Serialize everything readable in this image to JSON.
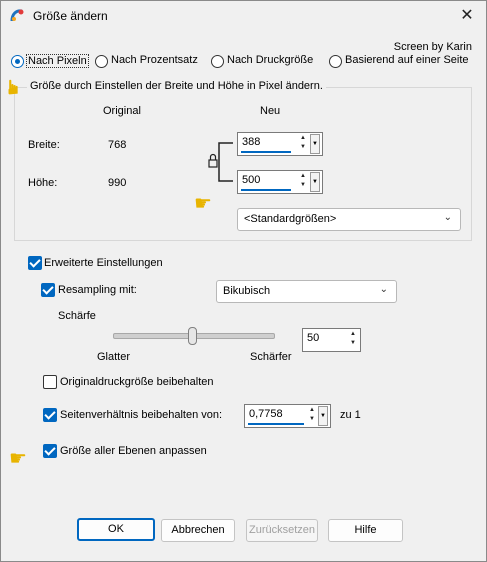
{
  "window": {
    "title": "Größe ändern"
  },
  "credit": "Screen by Karin",
  "mode": {
    "options": [
      "Nach Pixeln",
      "Nach Prozentsatz",
      "Nach Druckgröße",
      "Basierend auf einer Seite"
    ],
    "selected": "Nach Pixeln"
  },
  "pixel_group": {
    "label": "Größe durch Einstellen der Breite und Höhe in Pixel ändern.",
    "col_original": "Original",
    "col_new": "Neu",
    "width_label": "Breite:",
    "height_label": "Höhe:",
    "orig_width": "768",
    "orig_height": "990",
    "new_width": "388",
    "new_height": "500",
    "preset": "<Standardgrößen>"
  },
  "advanced": {
    "label": "Erweiterte Einstellungen",
    "resampling_label": "Resampling mit:",
    "resampling_value": "Bikubisch",
    "sharpness_label": "Schärfe",
    "slider_min_label": "Glatter",
    "slider_max_label": "Schärfer",
    "sharpness_value": "50",
    "keep_print_size_label": "Originaldruckgröße beibehalten",
    "keep_aspect_label": "Seitenverhältnis beibehalten von:",
    "aspect_value": "0,7758",
    "aspect_suffix": "zu 1",
    "resize_layers_label": "Größe aller Ebenen anpassen"
  },
  "buttons": {
    "ok": "OK",
    "cancel": "Abbrechen",
    "reset": "Zurücksetzen",
    "help": "Hilfe"
  },
  "colors": {
    "accent": "#0067c0",
    "pointer": "#f2c200"
  }
}
